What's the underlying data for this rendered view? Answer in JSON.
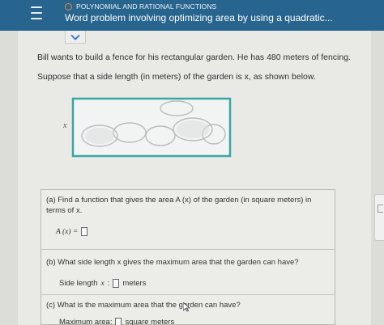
{
  "header": {
    "topic": "POLYNOMIAL AND RATIONAL FUNCTIONS",
    "title": "Word problem involving optimizing area by using a quadratic...",
    "menu_icon": "hamburger-menu-icon",
    "topic_dot_color": "#f08a3c",
    "bar_color": "#27648e"
  },
  "problem": {
    "line1": "Bill wants to build a fence for his rectangular garden. He has 480 meters of fencing.",
    "line2": "Suppose that a side length (in meters) of the garden is x, as shown below.",
    "diagram_side_label": "x"
  },
  "questions": {
    "a": {
      "line1": "(a) Find a function that gives the area A (x) of the garden (in square meters) in",
      "line2": "terms of x.",
      "answer_label": "A (x) ="
    },
    "b": {
      "text": "(b) What side length x gives the maximum area that the garden can have?",
      "answer_label_1": "Side length",
      "answer_label_var": "x",
      "answer_label_2": ":",
      "unit": "meters"
    },
    "c": {
      "text": "(c) What is the maximum area that the garden can have?",
      "answer_label": "Maximum area:",
      "unit": "square meters"
    }
  }
}
